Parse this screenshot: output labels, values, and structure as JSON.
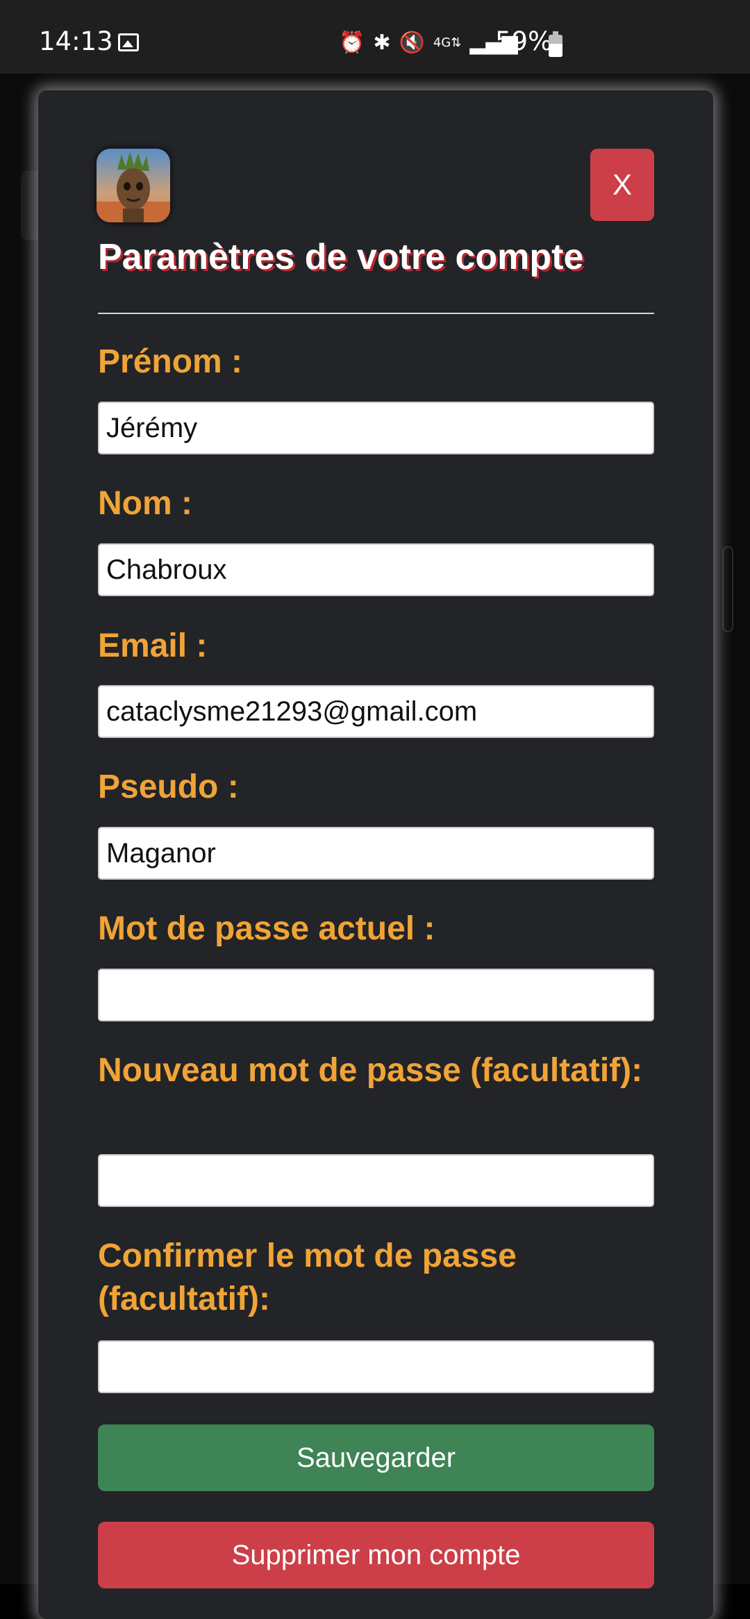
{
  "status_bar": {
    "time": "14:13",
    "battery": "59%",
    "icons": [
      "gallery-icon",
      "alarm-icon",
      "bluetooth-icon",
      "mute-icon",
      "4g-icon",
      "signal-icon",
      "battery-icon"
    ]
  },
  "modal": {
    "title": "Paramètres de votre compte",
    "close_label": "X",
    "fields": {
      "prenom": {
        "label": "Prénom :",
        "value": "Jérémy"
      },
      "nom": {
        "label": "Nom :",
        "value": "Chabroux"
      },
      "email": {
        "label": "Email :",
        "value": "cataclysme21293@gmail.com"
      },
      "pseudo": {
        "label": "Pseudo :",
        "value": "Maganor"
      },
      "current_password": {
        "label": "Mot de passe actuel :",
        "value": ""
      },
      "new_password": {
        "label": "Nouveau mot de passe (facultatif):",
        "value": ""
      },
      "confirm_password": {
        "label": "Confirmer le mot de passe (facultatif):",
        "value": ""
      }
    },
    "save_label": "Sauvegarder",
    "delete_label": "Supprimer mon compte"
  },
  "colors": {
    "label": "#f0a437",
    "danger": "#cc3f48",
    "success": "#3e8455",
    "modal_bg": "#222428"
  }
}
